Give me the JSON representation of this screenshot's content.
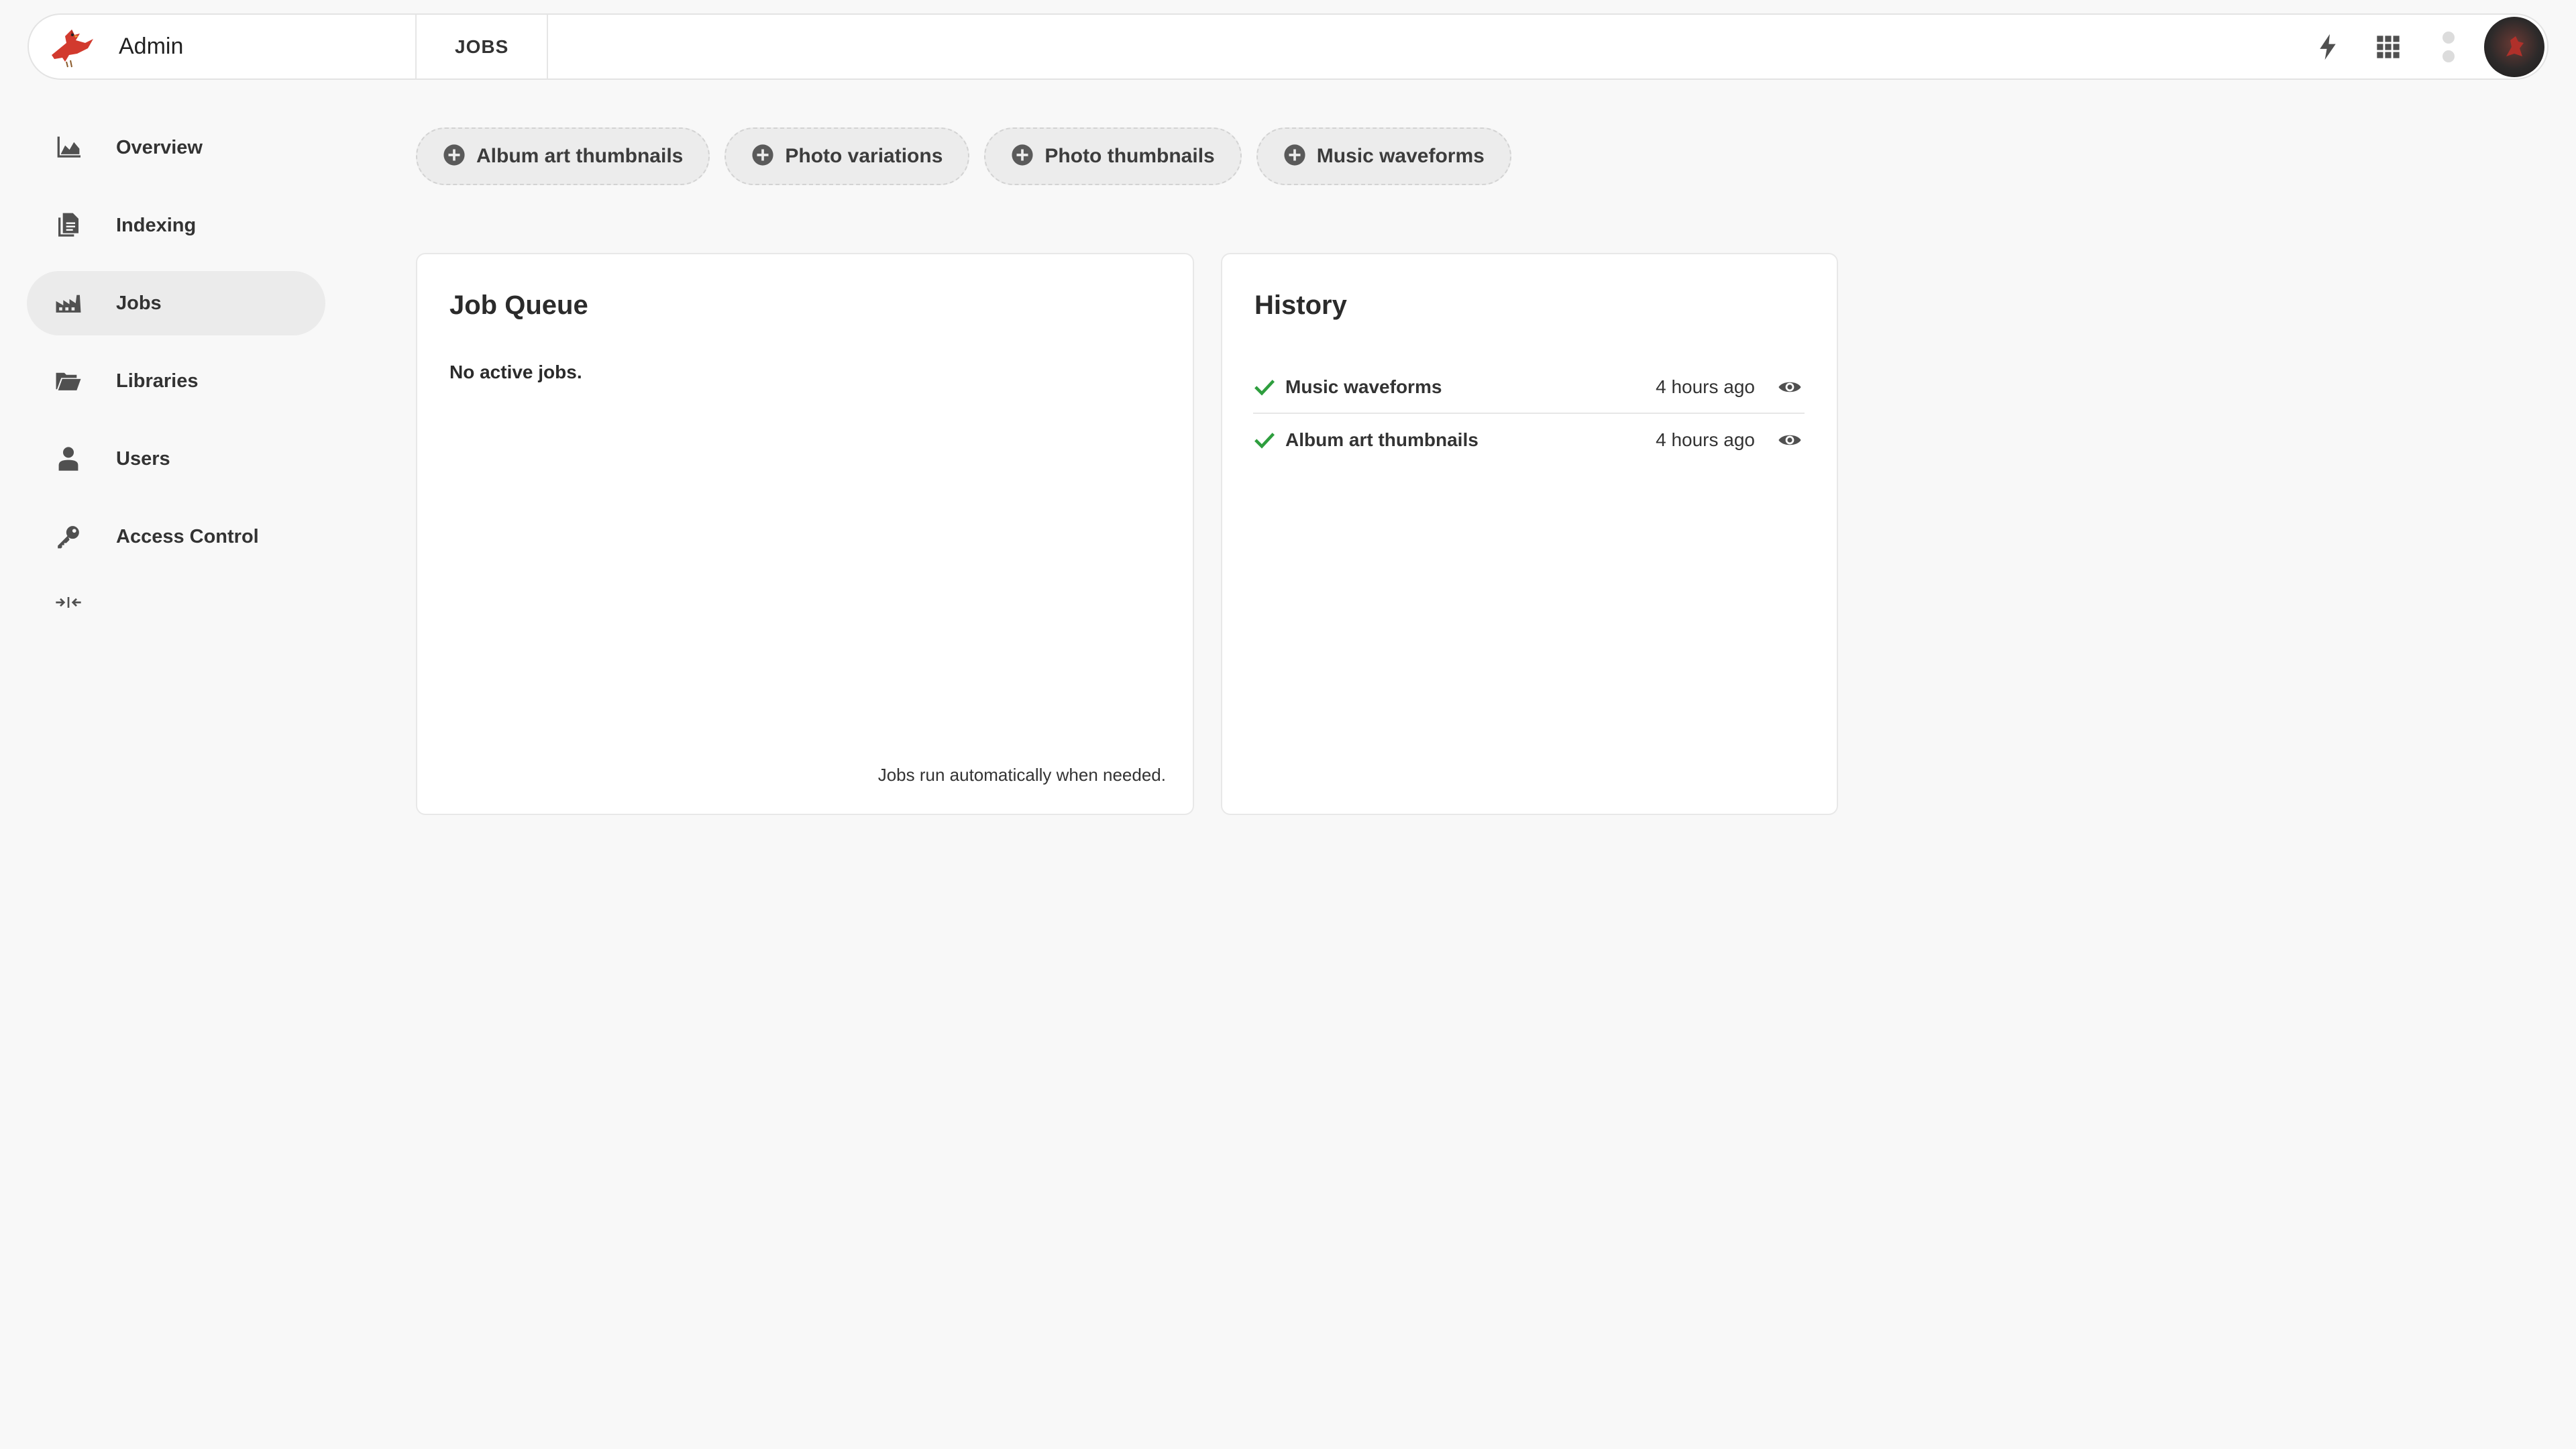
{
  "header": {
    "brand_title": "Admin",
    "breadcrumb": "JOBS",
    "icons": [
      "flash-icon",
      "apps-grid-icon",
      "status-dots-icon",
      "avatar"
    ]
  },
  "sidebar": {
    "items": [
      {
        "label": "Overview",
        "icon": "chart-area-icon",
        "active": false
      },
      {
        "label": "Indexing",
        "icon": "documents-icon",
        "active": false
      },
      {
        "label": "Jobs",
        "icon": "factory-icon",
        "active": true
      },
      {
        "label": "Libraries",
        "icon": "folder-open-icon",
        "active": false
      },
      {
        "label": "Users",
        "icon": "person-icon",
        "active": false
      },
      {
        "label": "Access Control",
        "icon": "key-icon",
        "active": false
      }
    ],
    "collapse_icon": "collapse-icon"
  },
  "chips": [
    {
      "label": "Album art thumbnails",
      "icon": "add-circle-icon"
    },
    {
      "label": "Photo variations",
      "icon": "add-circle-icon"
    },
    {
      "label": "Photo thumbnails",
      "icon": "add-circle-icon"
    },
    {
      "label": "Music waveforms",
      "icon": "add-circle-icon"
    }
  ],
  "queue": {
    "title": "Job Queue",
    "empty_text": "No active jobs.",
    "footer": "Jobs run automatically when needed."
  },
  "history": {
    "title": "History",
    "items": [
      {
        "name": "Music waveforms",
        "time": "4 hours ago",
        "status": "success"
      },
      {
        "name": "Album art thumbnails",
        "time": "4 hours ago",
        "status": "success"
      }
    ]
  },
  "colors": {
    "accent_success": "#2e9e3e",
    "brand_red": "#d23a2e",
    "icon_gray": "#505050"
  }
}
